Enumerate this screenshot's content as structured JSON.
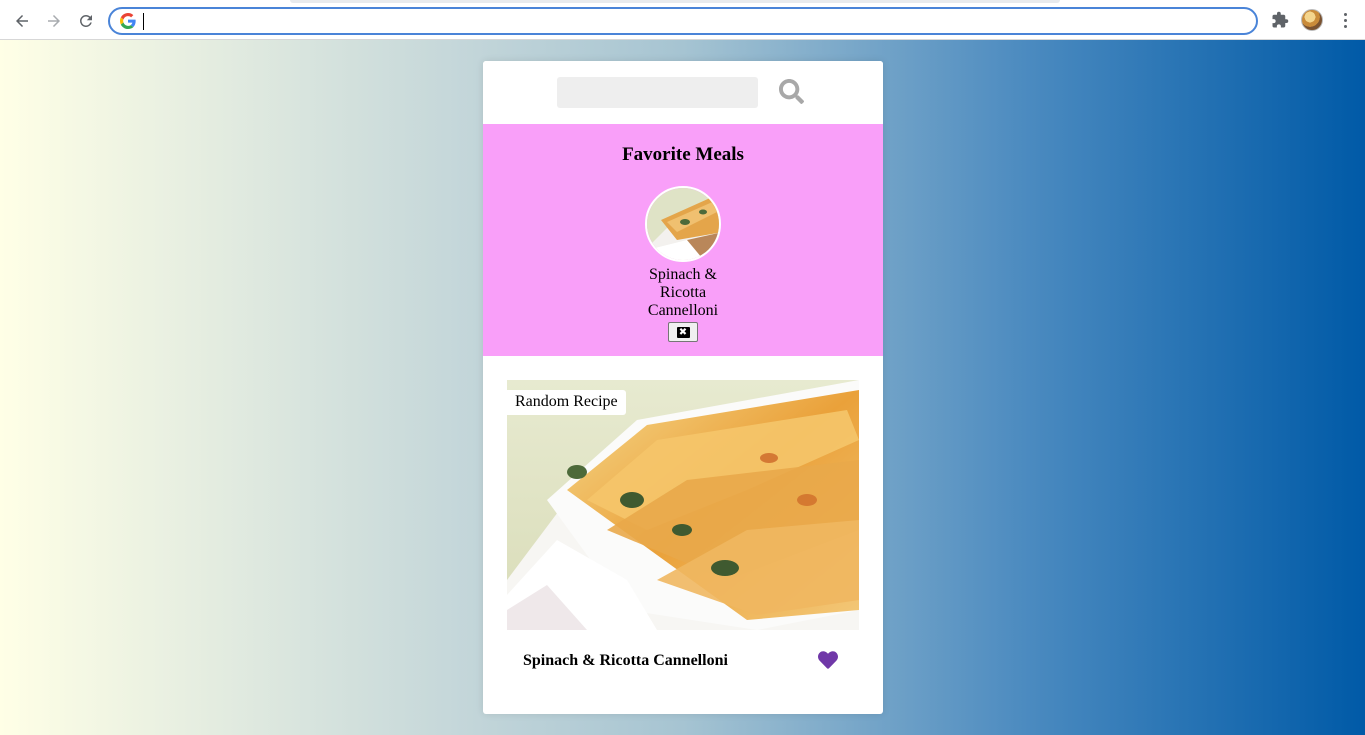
{
  "browser": {
    "address_value": "",
    "icons": [
      "back-arrow-icon",
      "forward-arrow-icon",
      "reload-icon",
      "google-icon",
      "extensions-icon",
      "profile-avatar",
      "kebab-menu-icon"
    ]
  },
  "colors": {
    "favorites_bg": "#f99ff9",
    "heart": "#7038a8",
    "gradient_start": "#ffffe6",
    "gradient_end": "#005aa7"
  },
  "search": {
    "value": "",
    "placeholder": "",
    "button_icon": "search-icon"
  },
  "favorites": {
    "title": "Favorite Meals",
    "items": [
      {
        "name": "Spinach & Ricotta Cannelloni",
        "remove_icon": "close-square-icon"
      }
    ]
  },
  "meal": {
    "tag": "Random Recipe",
    "name": "Spinach & Ricotta Cannelloni",
    "favorite_icon": "heart-icon",
    "favorited": true
  }
}
